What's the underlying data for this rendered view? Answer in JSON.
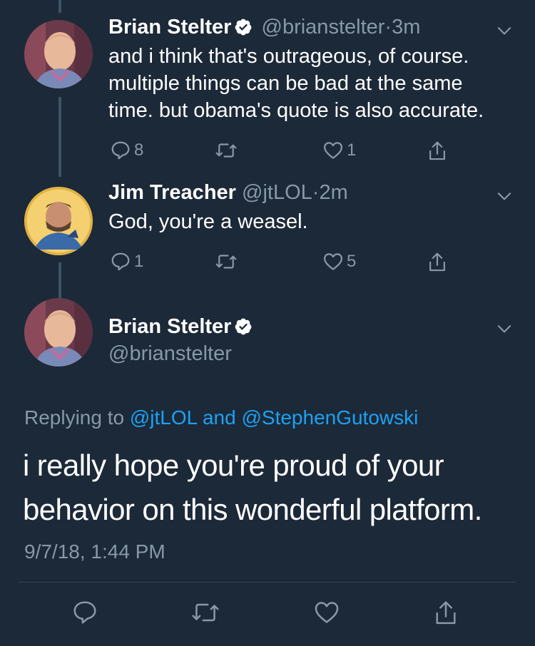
{
  "tweets": [
    {
      "name": "Brian Stelter",
      "handle": "@brianstelter",
      "dot": "·",
      "time": "3m",
      "text_lines": [
        "and i think that's outrageous, of course.",
        "multiple things can be bad at the same",
        "time. but obama's quote is also accurate."
      ],
      "reply_count": "8",
      "retweet_count": "",
      "like_count": "1"
    },
    {
      "name": "Jim Treacher",
      "handle": "@jtLOL",
      "dot": "·",
      "time": "2m",
      "text_lines": [
        "God, you're a weasel."
      ],
      "reply_count": "1",
      "retweet_count": "",
      "like_count": "5"
    }
  ],
  "main_tweet": {
    "name": "Brian Stelter",
    "handle": "@brianstelter",
    "replying_prefix": "Replying to ",
    "replying_user1": "@jtLOL",
    "replying_and": " and ",
    "replying_user2": "@StephenGutowski",
    "text_lines": [
      "i really hope you're proud of your",
      "behavior on this wonderful platform."
    ],
    "timestamp": "9/7/18, 1:44 PM"
  },
  "colors": {
    "background": "#1c2938",
    "secondary_text": "#8899a6",
    "link": "#1da1f2",
    "thread_line": "#3d5466"
  },
  "icons": [
    "reply-icon",
    "retweet-icon",
    "like-icon",
    "share-icon",
    "verified-icon",
    "chevron-down-icon"
  ]
}
